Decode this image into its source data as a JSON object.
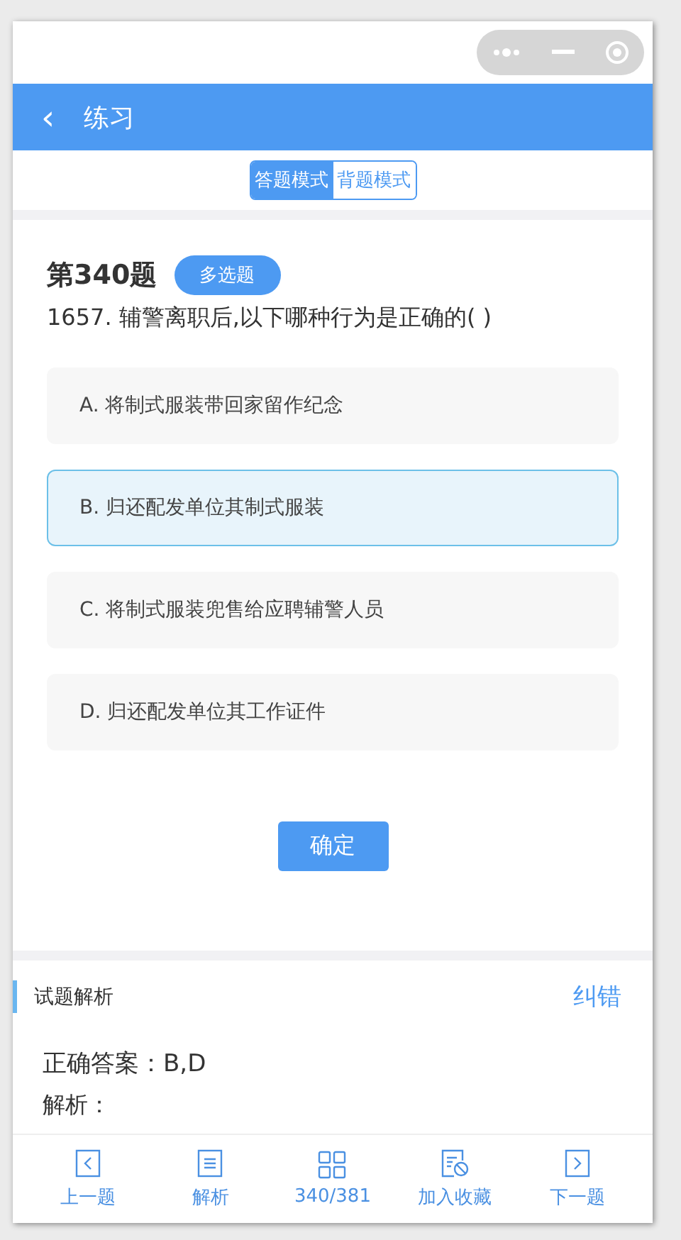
{
  "header": {
    "back": "‹",
    "title": "练习"
  },
  "modes": [
    {
      "label": "答题模式",
      "selected": true
    },
    {
      "label": "背题模式",
      "selected": false
    }
  ],
  "question": {
    "number": "第340题",
    "type": "多选题",
    "text": "1657. 辅警离职后,以下哪种行为是正确的( )"
  },
  "options": [
    {
      "label": "A. 将制式服装带回家留作纪念",
      "selected": false
    },
    {
      "label": "B. 归还配发单位其制式服装",
      "selected": true
    },
    {
      "label": "C. 将制式服装兜售给应聘辅警人员",
      "selected": false
    },
    {
      "label": "D. 归还配发单位其工作证件",
      "selected": false
    }
  ],
  "confirm": "确定",
  "analysis": {
    "title": "试题解析",
    "report": "纠错",
    "answer": "正确答案：B,D",
    "label": "解析："
  },
  "nav": [
    {
      "kind": "prev",
      "label": "上一题"
    },
    {
      "kind": "analysis",
      "label": "解析"
    },
    {
      "kind": "grid",
      "label": "340/381"
    },
    {
      "kind": "favorite",
      "label": "加入收藏"
    },
    {
      "kind": "next",
      "label": "下一题"
    }
  ]
}
